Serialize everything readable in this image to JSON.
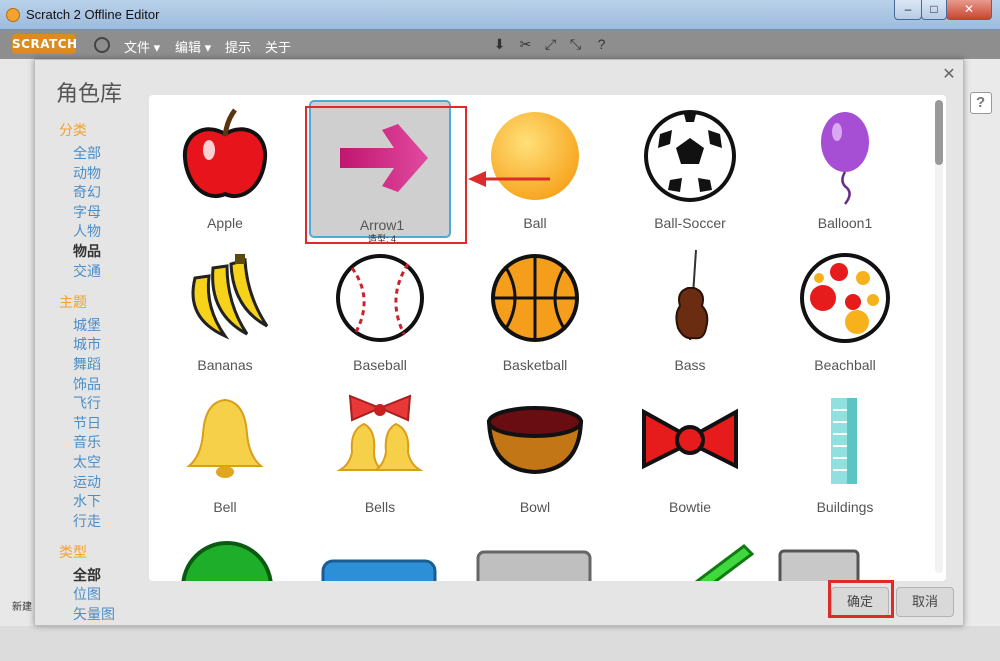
{
  "window": {
    "title": "Scratch 2 Offline Editor"
  },
  "menubar": {
    "logo": "SCRATCH",
    "items": [
      "文件 ▾",
      "编辑 ▾",
      "提示",
      "关于"
    ]
  },
  "dialog": {
    "title": "角色库",
    "sidebar": {
      "groups": [
        {
          "title": "分类",
          "items": [
            "全部",
            "动物",
            "奇幻",
            "字母",
            "人物",
            "物品",
            "交通"
          ],
          "active": "物品"
        },
        {
          "title": "主题",
          "items": [
            "城堡",
            "城市",
            "舞蹈",
            "饰品",
            "飞行",
            "节日",
            "音乐",
            "太空",
            "运动",
            "水下",
            "行走"
          ],
          "active": null
        },
        {
          "title": "类型",
          "items": [
            "全部",
            "位图",
            "矢量图"
          ],
          "active": "全部"
        }
      ]
    },
    "sprites": [
      {
        "name": "Apple",
        "icon": "apple-icon"
      },
      {
        "name": "Arrow1",
        "icon": "arrow-icon",
        "selected": true,
        "costume_label": "造型: 4"
      },
      {
        "name": "Ball",
        "icon": "ball-icon"
      },
      {
        "name": "Ball-Soccer",
        "icon": "soccer-ball-icon"
      },
      {
        "name": "Balloon1",
        "icon": "balloon-icon"
      },
      {
        "name": "Bananas",
        "icon": "bananas-icon"
      },
      {
        "name": "Baseball",
        "icon": "baseball-icon"
      },
      {
        "name": "Basketball",
        "icon": "basketball-icon"
      },
      {
        "name": "Bass",
        "icon": "bass-icon"
      },
      {
        "name": "Beachball",
        "icon": "beachball-icon"
      },
      {
        "name": "Bell",
        "icon": "bell-icon"
      },
      {
        "name": "Bells",
        "icon": "bells-icon"
      },
      {
        "name": "Bowl",
        "icon": "bowl-icon"
      },
      {
        "name": "Bowtie",
        "icon": "bowtie-icon"
      },
      {
        "name": "Buildings",
        "icon": "buildings-icon"
      }
    ],
    "buttons": {
      "ok": "确定",
      "cancel": "取消"
    }
  },
  "background": {
    "new_label": "新建"
  },
  "colors": {
    "accent_orange": "#f2a12e",
    "link_blue": "#4a8ec9",
    "highlight_red": "#dd2b2b"
  }
}
